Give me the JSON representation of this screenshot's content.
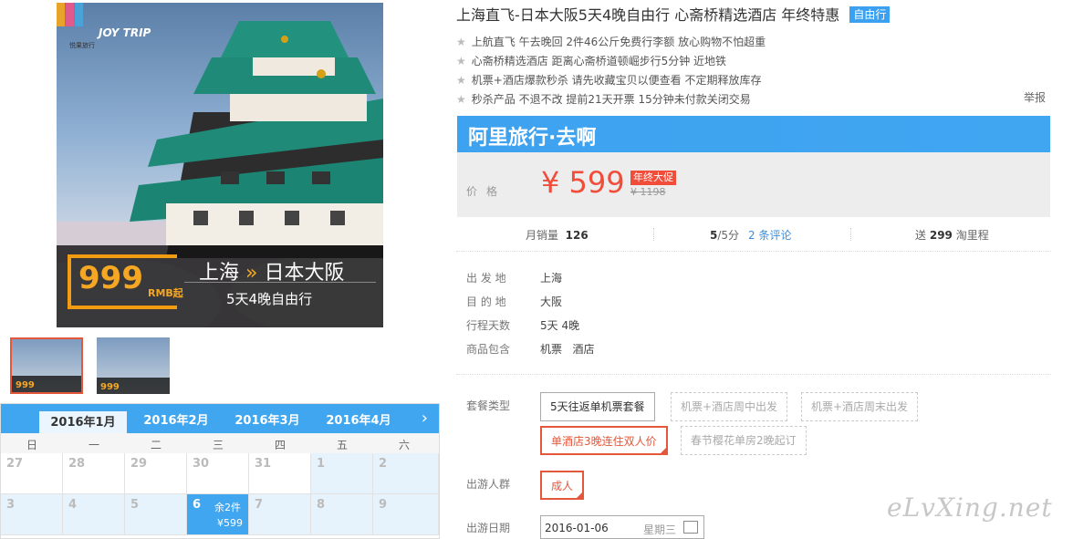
{
  "gallery": {
    "brand": "JOY TRIP",
    "brand_small": "悦果旅行",
    "promo_price": "999",
    "promo_unit": "RMB起",
    "promo_from": "上海",
    "promo_to": "日本大阪",
    "promo_sub": "5天4晚自由行",
    "thumb_price": "999"
  },
  "calendar": {
    "tabs": [
      "2016年1月",
      "2016年2月",
      "2016年3月",
      "2016年4月"
    ],
    "weekdays": [
      "日",
      "一",
      "二",
      "三",
      "四",
      "五",
      "六"
    ],
    "row1": [
      "27",
      "28",
      "29",
      "30",
      "31",
      "1",
      "2"
    ],
    "row2": [
      "3",
      "4",
      "5",
      "6",
      "7",
      "8",
      "9"
    ],
    "selected_stock": "余2件",
    "selected_price": "¥599"
  },
  "product": {
    "title": "上海直飞-日本大阪5天4晚自由行 心斋桥精选酒店 年终特惠",
    "badge": "自由行",
    "features": [
      "上航直飞 午去晚回 2件46公斤免费行李额 放心购物不怕超重",
      "心斋桥精选酒店 距离心斋桥道顿崛步行5分钟 近地铁",
      "机票+酒店爆款秒杀 请先收藏宝贝以便查看 不定期释放库存",
      "秒杀产品 不退不改 提前21天开票 15分钟未付款关闭交易"
    ],
    "report": "举报",
    "banner": "阿里旅行·去啊",
    "price_label": "价格",
    "price": "¥ 599",
    "price_tag": "年终大促",
    "price_old": "¥ 1198"
  },
  "stats": {
    "sales_label": "月销量",
    "sales": "126",
    "rating": "5",
    "rating_of": "/5分",
    "reviews": "2 条评论",
    "miles_pre": "送",
    "miles": "299",
    "miles_post": "淘里程"
  },
  "info": {
    "depart_label": "出 发 地",
    "depart": "上海",
    "dest_label": "目 的 地",
    "dest": "大阪",
    "days_label": "行程天数",
    "days": "5天 4晚",
    "includes_label": "商品包含",
    "includes": "机票   酒店"
  },
  "options": {
    "package_label": "套餐类型",
    "packages": [
      "5天往返单机票套餐",
      "机票+酒店周中出发",
      "机票+酒店周末出发",
      "单酒店3晚连住双人价",
      "春节樱花单房2晚起订"
    ],
    "people_label": "出游人群",
    "people": "成人",
    "date_label": "出游日期",
    "date": "2016-01-06",
    "weekday": "星期三"
  },
  "watermark": "eLvXing.net"
}
